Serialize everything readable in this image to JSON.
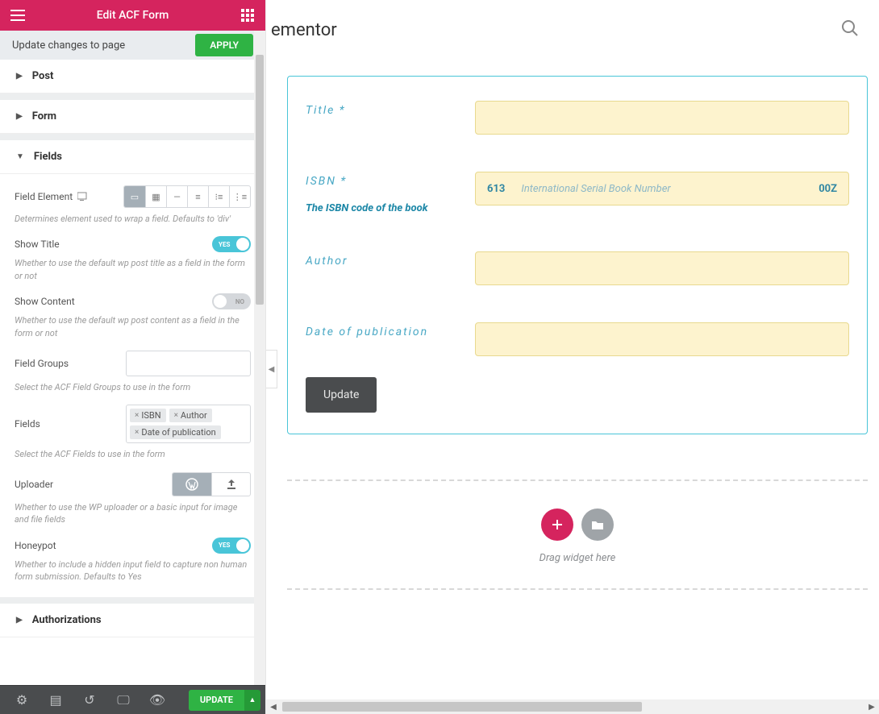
{
  "colors": {
    "accent": "#d5245e",
    "success": "#2fb344",
    "teal": "#49c5d8"
  },
  "sidebar": {
    "title": "Edit ACF Form",
    "apply_row_label": "Update changes to page",
    "apply_button": "APPLY",
    "sections": {
      "post": "Post",
      "form": "Form",
      "fields": "Fields",
      "authorizations": "Authorizations"
    },
    "fields_section": {
      "field_element_label": "Field Element",
      "field_element_hint": "Determines element used to wrap a field. Defaults to 'div'",
      "show_title_label": "Show Title",
      "show_title_value": "YES",
      "show_title_hint": "Whether to use the default wp post title as a field in the form or not",
      "show_content_label": "Show Content",
      "show_content_value": "NO",
      "show_content_hint": "Whether to use the default wp post content as a field in the form or not",
      "field_groups_label": "Field Groups",
      "field_groups_value": "",
      "field_groups_hint": "Select the ACF Field Groups to use in the form",
      "fields_label": "Fields",
      "fields_tags": [
        "ISBN",
        "Author",
        "Date of publication"
      ],
      "fields_hint": "Select the ACF Fields to use in the form",
      "uploader_label": "Uploader",
      "uploader_hint": "Whether to use the WP uploader or a basic input for image and file fields",
      "honeypot_label": "Honeypot",
      "honeypot_value": "YES",
      "honeypot_hint": "Whether to include a hidden input field to capture non human form submission. Defaults to Yes"
    },
    "bottom_bar": {
      "update": "UPDATE"
    }
  },
  "main": {
    "page_title_suffix": "ementor",
    "form": {
      "rows": [
        {
          "label": "Title *",
          "sub": ""
        },
        {
          "label": "ISBN *",
          "sub": "The ISBN code of the book",
          "prefix": "613",
          "placeholder": "International Serial Book Number",
          "suffix": "00Z"
        },
        {
          "label": "Author",
          "sub": ""
        },
        {
          "label": "Date of publication",
          "sub": ""
        }
      ],
      "submit": "Update"
    },
    "drop_label": "Drag widget here"
  }
}
